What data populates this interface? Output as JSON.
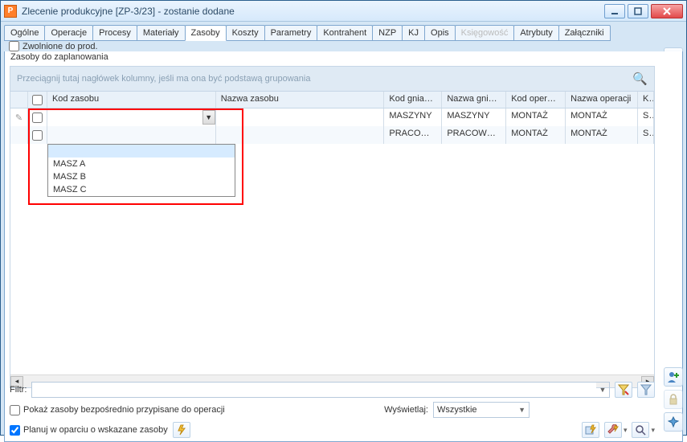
{
  "window": {
    "title": "Zlecenie produkcyjne  [ZP-3/23] - zostanie dodane"
  },
  "tabs": {
    "items": [
      "Ogólne",
      "Operacje",
      "Procesy",
      "Materiały",
      "Zasoby",
      "Koszty",
      "Parametry",
      "Kontrahent",
      "NZP",
      "KJ",
      "Opis",
      "Księgowość",
      "Atrybuty",
      "Załączniki"
    ],
    "active_index": 4,
    "disabled_index": 11
  },
  "right_check": {
    "label": "Zwolnione do prod."
  },
  "section": {
    "label": "Zasoby do zaplanowania"
  },
  "grid": {
    "group_hint": "Przeciągnij tutaj nagłówek kolumny, jeśli ma ona być podstawą grupowania",
    "columns": {
      "kod_zasobu": "Kod zasobu",
      "nazwa_zasobu": "Nazwa zasobu",
      "kod_gniazda": "Kod gniazda",
      "nazwa_gniazda": "Nazwa gniazda",
      "kod_operacji": "Kod operacji",
      "nazwa_operacji": "Nazwa operacji",
      "last": "Ko"
    },
    "rows": [
      {
        "kod_gniazda": "MASZYNY",
        "nazwa_gniazda": "MASZYNY",
        "kod_operacji": "MONTAŻ",
        "nazwa_operacji": "MONTAŻ",
        "last": "ST"
      },
      {
        "kod_gniazda": "PRACOW…",
        "nazwa_gniazda": "PRACOWNICY",
        "kod_operacji": "MONTAŻ",
        "nazwa_operacji": "MONTAŻ",
        "last": "ST"
      }
    ],
    "dropdown": {
      "options": [
        "MASZ A",
        "MASZ B",
        "MASZ C"
      ]
    }
  },
  "filter": {
    "label": "Filtr:"
  },
  "chk_bezp": {
    "label": "Pokaż zasoby bezpośrednio przypisane do operacji"
  },
  "wyswietlaj": {
    "label": "Wyświetlaj:",
    "value": "Wszystkie"
  },
  "chk_planuj": {
    "label": "Planuj w oparciu o wskazane zasoby",
    "checked": true
  },
  "icons": {
    "save": "save-icon",
    "delete": "delete-icon",
    "person": "person-plus-icon",
    "lock": "lock-icon",
    "pin": "pin-icon",
    "funnel_edit": "funnel-edit-icon",
    "funnel": "funnel-icon",
    "bolt": "bolt-icon",
    "plan_bolt": "plan-bolt-icon",
    "wrench_bolt": "wrench-bolt-icon",
    "zoom": "zoom-dropdown-icon"
  }
}
